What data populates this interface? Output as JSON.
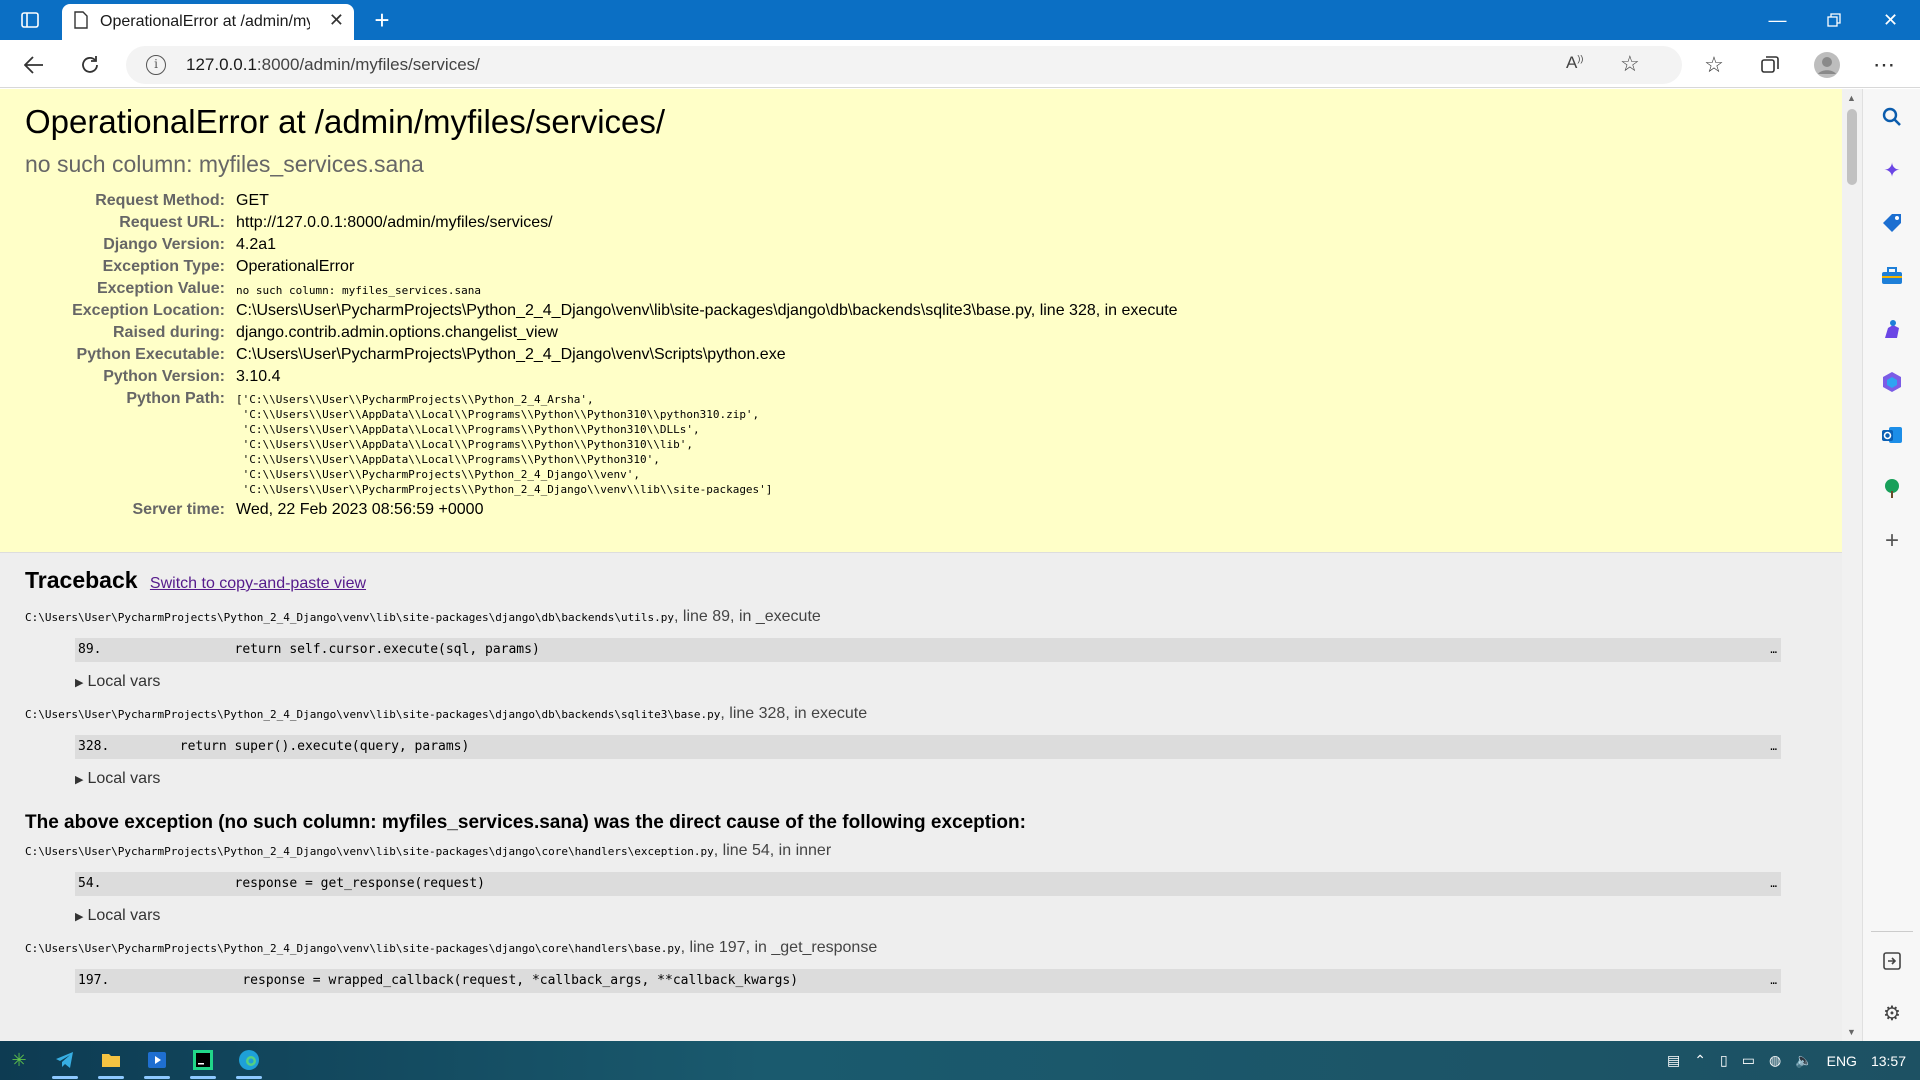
{
  "browser": {
    "tab_title": "OperationalError at /admin/myfiles/services/",
    "url_host": "127.0.0.1",
    "url_rest": ":8000/admin/myfiles/services/"
  },
  "page": {
    "title": "OperationalError at /admin/myfiles/services/",
    "subtitle": "no such column: myfiles_services.sana",
    "meta": [
      {
        "label": "Request Method:",
        "value": "GET"
      },
      {
        "label": "Request URL:",
        "value": "http://127.0.0.1:8000/admin/myfiles/services/"
      },
      {
        "label": "Django Version:",
        "value": "4.2a1"
      },
      {
        "label": "Exception Type:",
        "value": "OperationalError"
      },
      {
        "label": "Exception Value:",
        "value": "no such column: myfiles_services.sana"
      },
      {
        "label": "Exception Location:",
        "value": "C:\\Users\\User\\PycharmProjects\\Python_2_4_Django\\venv\\lib\\site-packages\\django\\db\\backends\\sqlite3\\base.py, line 328, in execute"
      },
      {
        "label": "Raised during:",
        "value": "django.contrib.admin.options.changelist_view"
      },
      {
        "label": "Python Executable:",
        "value": "C:\\Users\\User\\PycharmProjects\\Python_2_4_Django\\venv\\Scripts\\python.exe"
      },
      {
        "label": "Python Version:",
        "value": "3.10.4"
      },
      {
        "label": "Python Path:",
        "value": "['C:\\\\Users\\\\User\\\\PycharmProjects\\\\Python_2_4_Arsha',\n 'C:\\\\Users\\\\User\\\\AppData\\\\Local\\\\Programs\\\\Python\\\\Python310\\\\python310.zip',\n 'C:\\\\Users\\\\User\\\\AppData\\\\Local\\\\Programs\\\\Python\\\\Python310\\\\DLLs',\n 'C:\\\\Users\\\\User\\\\AppData\\\\Local\\\\Programs\\\\Python\\\\Python310\\\\lib',\n 'C:\\\\Users\\\\User\\\\AppData\\\\Local\\\\Programs\\\\Python\\\\Python310',\n 'C:\\\\Users\\\\User\\\\PycharmProjects\\\\Python_2_4_Django\\\\venv',\n 'C:\\\\Users\\\\User\\\\PycharmProjects\\\\Python_2_4_Django\\\\venv\\\\lib\\\\site-packages']"
      },
      {
        "label": "Server time:",
        "value": "Wed, 22 Feb 2023 08:56:59 +0000"
      }
    ]
  },
  "traceback": {
    "title": "Traceback",
    "switch_link": "Switch to copy-and-paste view",
    "local_vars": "Local vars",
    "cause": "The above exception (no such column: myfiles_services.sana) was the direct cause of the following exception:",
    "frames": [
      {
        "file": "C:\\Users\\User\\PycharmProjects\\Python_2_4_Django\\venv\\lib\\site-packages\\django\\db\\backends\\utils.py",
        "where": ", line 89, in _execute",
        "line": "89.                 return self.cursor.execute(sql, params)"
      },
      {
        "file": "C:\\Users\\User\\PycharmProjects\\Python_2_4_Django\\venv\\lib\\site-packages\\django\\db\\backends\\sqlite3\\base.py",
        "where": ", line 328, in execute",
        "line": "328.         return super().execute(query, params)"
      },
      {
        "file": "C:\\Users\\User\\PycharmProjects\\Python_2_4_Django\\venv\\lib\\site-packages\\django\\core\\handlers\\exception.py",
        "where": ", line 54, in inner",
        "line": "54.                 response = get_response(request)"
      },
      {
        "file": "C:\\Users\\User\\PycharmProjects\\Python_2_4_Django\\venv\\lib\\site-packages\\django\\core\\handlers\\base.py",
        "where": ", line 197, in _get_response",
        "line": "197.                 response = wrapped_callback(request, *callback_args, **callback_kwargs)"
      }
    ],
    "dots": "…"
  },
  "taskbar": {
    "lang": "ENG",
    "time": "13:57"
  }
}
